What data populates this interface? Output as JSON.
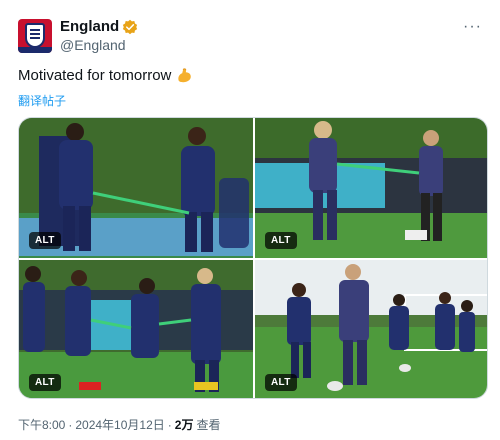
{
  "author": {
    "display_name": "England",
    "handle": "@England",
    "verified_badge_color": "#e8a317"
  },
  "tweet": {
    "text": "Motivated for tomorrow",
    "emoji": "flexed-biceps-icon",
    "translate_label": "翻译帖子"
  },
  "media": [
    {
      "alt_label": "ALT"
    },
    {
      "alt_label": "ALT"
    },
    {
      "alt_label": "ALT"
    },
    {
      "alt_label": "ALT"
    }
  ],
  "meta": {
    "time": "下午8:00",
    "separator": "·",
    "date": "2024年10月12日",
    "views_count": "2万",
    "views_label": "查看"
  },
  "colors": {
    "link": "#1d9bf0",
    "secondary_text": "#536471",
    "brand_red": "#c8102e",
    "brand_navy": "#1b2a6b"
  }
}
